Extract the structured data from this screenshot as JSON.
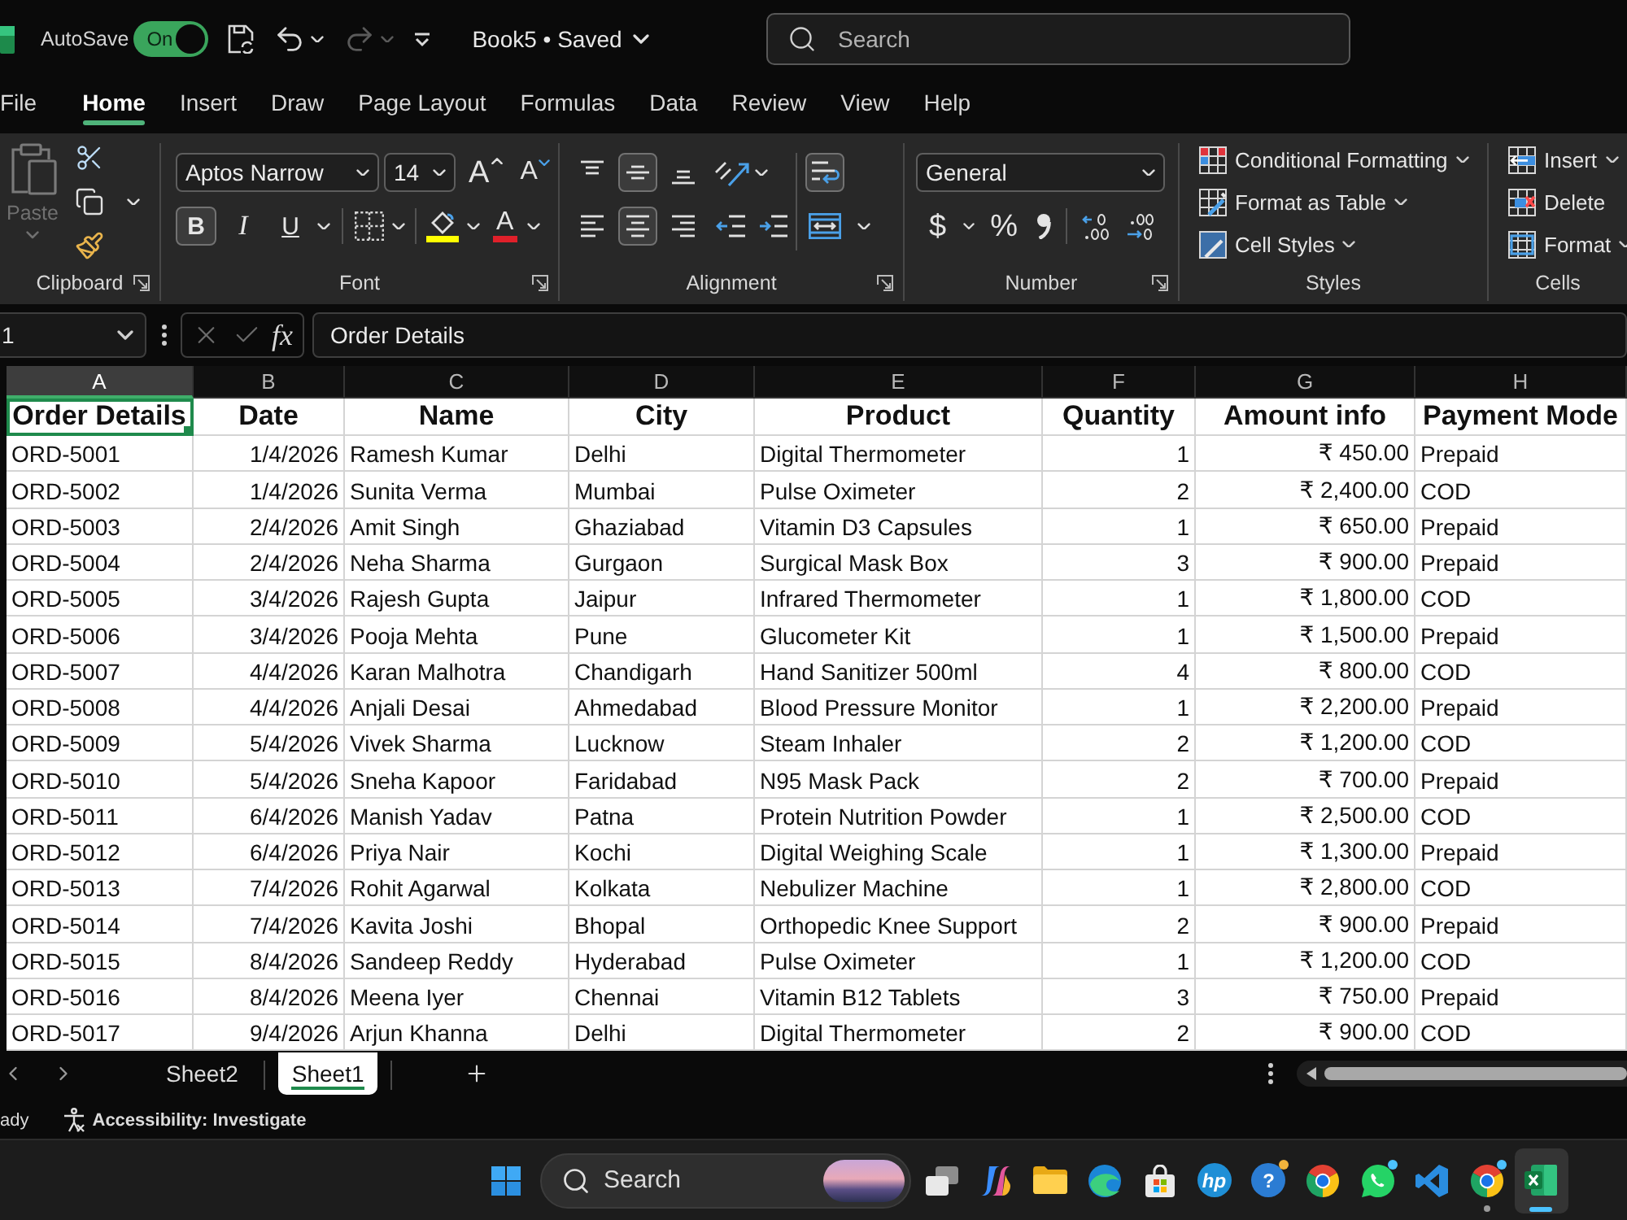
{
  "title_bar": {
    "autosave": {
      "label": "AutoSave",
      "toggle_text": "On",
      "on": true
    },
    "quick_access": [
      {
        "kind": "save",
        "disabled": false
      },
      {
        "kind": "undo",
        "disabled": false
      },
      {
        "kind": "redo",
        "disabled": true
      },
      {
        "kind": "customize",
        "disabled": false
      }
    ],
    "document": "Book5 • Saved",
    "search": {
      "placeholder": "Search"
    }
  },
  "menu_tabs": [
    {
      "label": "File",
      "selected": false
    },
    {
      "label": "Home",
      "selected": true
    },
    {
      "label": "Insert",
      "selected": false
    },
    {
      "label": "Draw",
      "selected": false
    },
    {
      "label": "Page Layout",
      "selected": false
    },
    {
      "label": "Formulas",
      "selected": false
    },
    {
      "label": "Data",
      "selected": false
    },
    {
      "label": "Review",
      "selected": false
    },
    {
      "label": "View",
      "selected": false
    },
    {
      "label": "Help",
      "selected": false
    }
  ],
  "ribbon": {
    "clipboard": {
      "label": "Clipboard",
      "paste": {
        "label": "Paste",
        "disabled": true
      }
    },
    "font": {
      "label": "Font",
      "font_name": "Aptos Narrow",
      "font_size": "14",
      "grow_glyph": "A",
      "shrink_glyph": "A",
      "styles": [
        {
          "kind": "bold",
          "glyph": "B",
          "on": true
        },
        {
          "kind": "italic",
          "glyph": "I",
          "on": false
        },
        {
          "kind": "underline",
          "glyph": "U",
          "on": false
        }
      ],
      "font_color_glyph": "A"
    },
    "alignment": {
      "label": "Alignment",
      "vertical": [
        {
          "kind": "top",
          "selected": false
        },
        {
          "kind": "middle",
          "selected": true
        },
        {
          "kind": "bottom",
          "selected": false
        }
      ],
      "horizontal": [
        {
          "kind": "left",
          "selected": false
        },
        {
          "kind": "center",
          "selected": true
        },
        {
          "kind": "right",
          "selected": false
        }
      ],
      "wrap_text": true
    },
    "number": {
      "label": "Number",
      "format": "General",
      "currency_glyph": "$",
      "percent_glyph": "%"
    },
    "styles": {
      "label": "Styles",
      "items": [
        {
          "kind": "conditional",
          "label": "Conditional Formatting",
          "menu": true
        },
        {
          "kind": "table",
          "label": "Format as Table",
          "menu": true
        },
        {
          "kind": "cell_styles",
          "label": "Cell Styles",
          "menu": true
        }
      ]
    },
    "cells": {
      "label": "Cells",
      "items": [
        {
          "kind": "insert",
          "label": "Insert",
          "menu": true
        },
        {
          "kind": "delete",
          "label": "Delete",
          "menu": false
        },
        {
          "kind": "format",
          "label": "Format",
          "menu": true
        }
      ]
    }
  },
  "formula_bar": {
    "name_box": "1",
    "function_glyph": "fx",
    "formula": "Order Details"
  },
  "sheet": {
    "columns": [
      {
        "letter": "A",
        "selected": true
      },
      {
        "letter": "B",
        "selected": false
      },
      {
        "letter": "C",
        "selected": false
      },
      {
        "letter": "D",
        "selected": false
      },
      {
        "letter": "E",
        "selected": false
      },
      {
        "letter": "F",
        "selected": false
      },
      {
        "letter": "G",
        "selected": false
      },
      {
        "letter": "H",
        "selected": false
      }
    ],
    "header": [
      "Order Details",
      "Date",
      "Name",
      "City",
      "Product",
      "Quantity",
      "Amount info",
      "Payment Mode"
    ],
    "rows": [
      [
        "ORD-5001",
        "1/4/2026",
        "Ramesh Kumar",
        "Delhi",
        "Digital Thermometer",
        "1",
        "₹ 450.00",
        "Prepaid"
      ],
      [
        "ORD-5002",
        "1/4/2026",
        "Sunita Verma",
        "Mumbai",
        "Pulse Oximeter",
        "2",
        "₹ 2,400.00",
        "COD"
      ],
      [
        "ORD-5003",
        "2/4/2026",
        "Amit Singh",
        "Ghaziabad",
        "Vitamin D3 Capsules",
        "1",
        "₹ 650.00",
        "Prepaid"
      ],
      [
        "ORD-5004",
        "2/4/2026",
        "Neha Sharma",
        "Gurgaon",
        "Surgical Mask Box",
        "3",
        "₹ 900.00",
        "Prepaid"
      ],
      [
        "ORD-5005",
        "3/4/2026",
        "Rajesh Gupta",
        "Jaipur",
        "Infrared Thermometer",
        "1",
        "₹ 1,800.00",
        "COD"
      ],
      [
        "ORD-5006",
        "3/4/2026",
        "Pooja Mehta",
        "Pune",
        "Glucometer Kit",
        "1",
        "₹ 1,500.00",
        "Prepaid"
      ],
      [
        "ORD-5007",
        "4/4/2026",
        "Karan Malhotra",
        "Chandigarh",
        "Hand Sanitizer 500ml",
        "4",
        "₹ 800.00",
        "COD"
      ],
      [
        "ORD-5008",
        "4/4/2026",
        "Anjali Desai",
        "Ahmedabad",
        "Blood Pressure Monitor",
        "1",
        "₹ 2,200.00",
        "Prepaid"
      ],
      [
        "ORD-5009",
        "5/4/2026",
        "Vivek Sharma",
        "Lucknow",
        "Steam Inhaler",
        "2",
        "₹ 1,200.00",
        "COD"
      ],
      [
        "ORD-5010",
        "5/4/2026",
        "Sneha Kapoor",
        "Faridabad",
        "N95 Mask Pack",
        "2",
        "₹ 700.00",
        "Prepaid"
      ],
      [
        "ORD-5011",
        "6/4/2026",
        "Manish Yadav",
        "Patna",
        "Protein Nutrition Powder",
        "1",
        "₹ 2,500.00",
        "COD"
      ],
      [
        "ORD-5012",
        "6/4/2026",
        "Priya Nair",
        "Kochi",
        "Digital Weighing Scale",
        "1",
        "₹ 1,300.00",
        "Prepaid"
      ],
      [
        "ORD-5013",
        "7/4/2026",
        "Rohit Agarwal",
        "Kolkata",
        "Nebulizer Machine",
        "1",
        "₹ 2,800.00",
        "COD"
      ],
      [
        "ORD-5014",
        "7/4/2026",
        "Kavita Joshi",
        "Bhopal",
        "Orthopedic Knee Support",
        "2",
        "₹ 900.00",
        "Prepaid"
      ],
      [
        "ORD-5015",
        "8/4/2026",
        "Sandeep Reddy",
        "Hyderabad",
        "Pulse Oximeter",
        "1",
        "₹ 1,200.00",
        "COD"
      ],
      [
        "ORD-5016",
        "8/4/2026",
        "Meena Iyer",
        "Chennai",
        "Vitamin B12 Tablets",
        "3",
        "₹ 750.00",
        "Prepaid"
      ],
      [
        "ORD-5017",
        "9/4/2026",
        "Arjun Khanna",
        "Delhi",
        "Digital Thermometer",
        "2",
        "₹ 900.00",
        "COD"
      ]
    ]
  },
  "sheet_tabs": [
    {
      "label": "Sheet2",
      "selected": false
    },
    {
      "label": "Sheet1",
      "selected": true
    }
  ],
  "status_bar": {
    "mode": "ady",
    "accessibility": "Accessibility: Investigate"
  },
  "taskbar": {
    "search": {
      "placeholder": "Search"
    },
    "apps": [
      {
        "kind": "task_view",
        "active": false,
        "running": false,
        "badge": false
      },
      {
        "kind": "copilot",
        "active": false,
        "running": false,
        "badge": false
      },
      {
        "kind": "file_explorer",
        "active": false,
        "running": false,
        "badge": false
      },
      {
        "kind": "edge",
        "active": false,
        "running": false,
        "badge": false
      },
      {
        "kind": "store",
        "active": false,
        "running": false,
        "badge": false
      },
      {
        "kind": "hp",
        "label": "hp",
        "active": false,
        "running": false,
        "badge": false
      },
      {
        "kind": "help",
        "label": "?",
        "active": false,
        "running": false,
        "badge": true,
        "color": "#f1b33c"
      },
      {
        "kind": "chrome",
        "active": false,
        "running": false,
        "badge": false
      },
      {
        "kind": "whatsapp",
        "active": false,
        "running": false,
        "badge": true,
        "color": "#4cc2ff"
      },
      {
        "kind": "vscode",
        "active": false,
        "running": false,
        "badge": false
      },
      {
        "kind": "chrome",
        "active": false,
        "running": true,
        "badge": true,
        "color": "#4cc2ff"
      },
      {
        "kind": "excel",
        "active": true,
        "running": false,
        "badge": false
      }
    ]
  }
}
